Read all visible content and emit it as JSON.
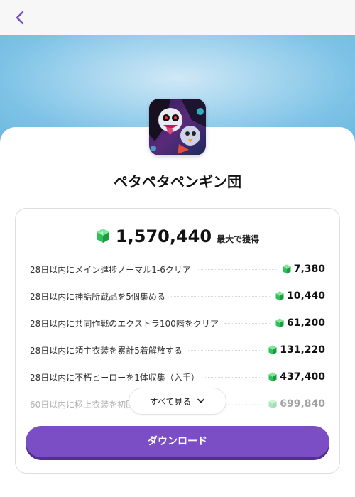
{
  "app": {
    "title": "ペタペタペンギン団",
    "icon": "game-app-icon"
  },
  "nav": {
    "back_icon": "chevron-left-icon",
    "accent": "#7b4ec6"
  },
  "rewards": {
    "total_value": "1,570,440",
    "total_suffix": "最大で獲得",
    "currency_icon": "green-gem-icon",
    "tasks": [
      {
        "label": "28日以内にメイン進捗ノーマル1-6クリア",
        "value": "7,380"
      },
      {
        "label": "28日以内に神話所蔵品を5個集める",
        "value": "10,440"
      },
      {
        "label": "28日以内に共同作戦のエクストラ100階をクリア",
        "value": "61,200"
      },
      {
        "label": "28日以内に領主衣装を累計5着解放する",
        "value": "131,220"
      },
      {
        "label": "28日以内に不朽ヒーローを1体収集（入手）",
        "value": "437,400"
      },
      {
        "label": "60日以内に極上衣装を初回",
        "value": "699,840"
      }
    ],
    "see_all_label": "すべて見る",
    "see_all_icon": "chevron-down-icon"
  },
  "actions": {
    "download_label": "ダウンロード",
    "download_color": "#7b4ec6"
  }
}
